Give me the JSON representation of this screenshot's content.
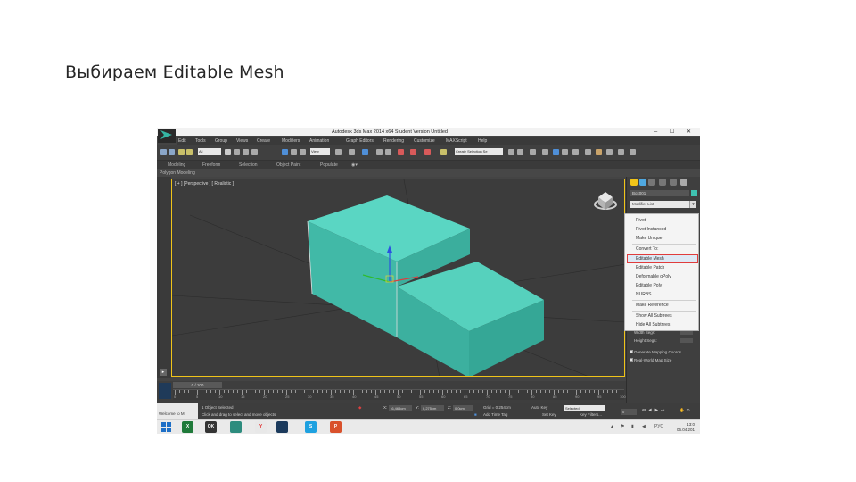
{
  "slide": {
    "title": "Выбираем Editable Mesh"
  },
  "app": {
    "window_title": "Autodesk 3ds Max  2014 x64    Student Version    Untitled",
    "menu": [
      "Edit",
      "Tools",
      "Group",
      "Views",
      "Create",
      "Modifiers",
      "Animation",
      "Graph Editors",
      "Rendering",
      "Customize",
      "MAXScript",
      "Help"
    ],
    "toolbar": {
      "selection_filter": "All",
      "ref_coord": "View",
      "named_sel": "Create Selection Se"
    },
    "ribbon_tabs": [
      "Modeling",
      "Freeform",
      "Selection",
      "Object Paint",
      "Populate"
    ],
    "ribbon_sub": "Polygon Modeling",
    "viewport_label": "[ + ] [Perspective ] [ Realistic ]",
    "command_panel": {
      "object_name": "Box001",
      "modifier_list": "Modifier List",
      "popup_items": [
        "Pivot",
        "Pivot Instanced",
        "Make Unique",
        "Convert To:",
        "Editable Mesh",
        "Editable Patch",
        "Deformable gPoly",
        "Editable Poly",
        "NURBS",
        "Make Reference",
        "Show All Subtrees",
        "Hide All Subtrees"
      ],
      "highlighted": "Editable Mesh",
      "params": [
        "Width Segs:",
        "Height Segs:"
      ],
      "checks": [
        "Generate Mapping Coords.",
        "Real-World Map Size"
      ]
    },
    "timeline": {
      "slider": "0 / 100",
      "ticks": [
        "0",
        "5",
        "10",
        "15",
        "20",
        "25",
        "30",
        "35",
        "40",
        "45",
        "50",
        "55",
        "60",
        "65",
        "70",
        "75",
        "80",
        "85",
        "90",
        "95",
        "100"
      ]
    },
    "status": {
      "welcome": "Welcome to M",
      "selected": "1 Object Selected",
      "hint": "Click and drag to select and move objects",
      "x_label": "X:",
      "x_val": "-6,465cm",
      "y_label": "Y:",
      "y_val": "0,275cm",
      "z_label": "Z:",
      "z_val": "0,0cm",
      "grid": "Grid = 0,254cm",
      "auto_key": "Auto Key",
      "auto_key_val": "Selected",
      "set_key": "Set Key",
      "key_filters": "Key Filters...",
      "add_time_tag": "Add Time Tag",
      "frame": "0"
    },
    "taskbar": {
      "tray_lang": "РУС",
      "time": "13:0",
      "date": "06.04.201"
    },
    "colors": {
      "box": "#49c6b4",
      "accent": "#35b6a4",
      "highlight_border": "#e03c3c"
    }
  }
}
